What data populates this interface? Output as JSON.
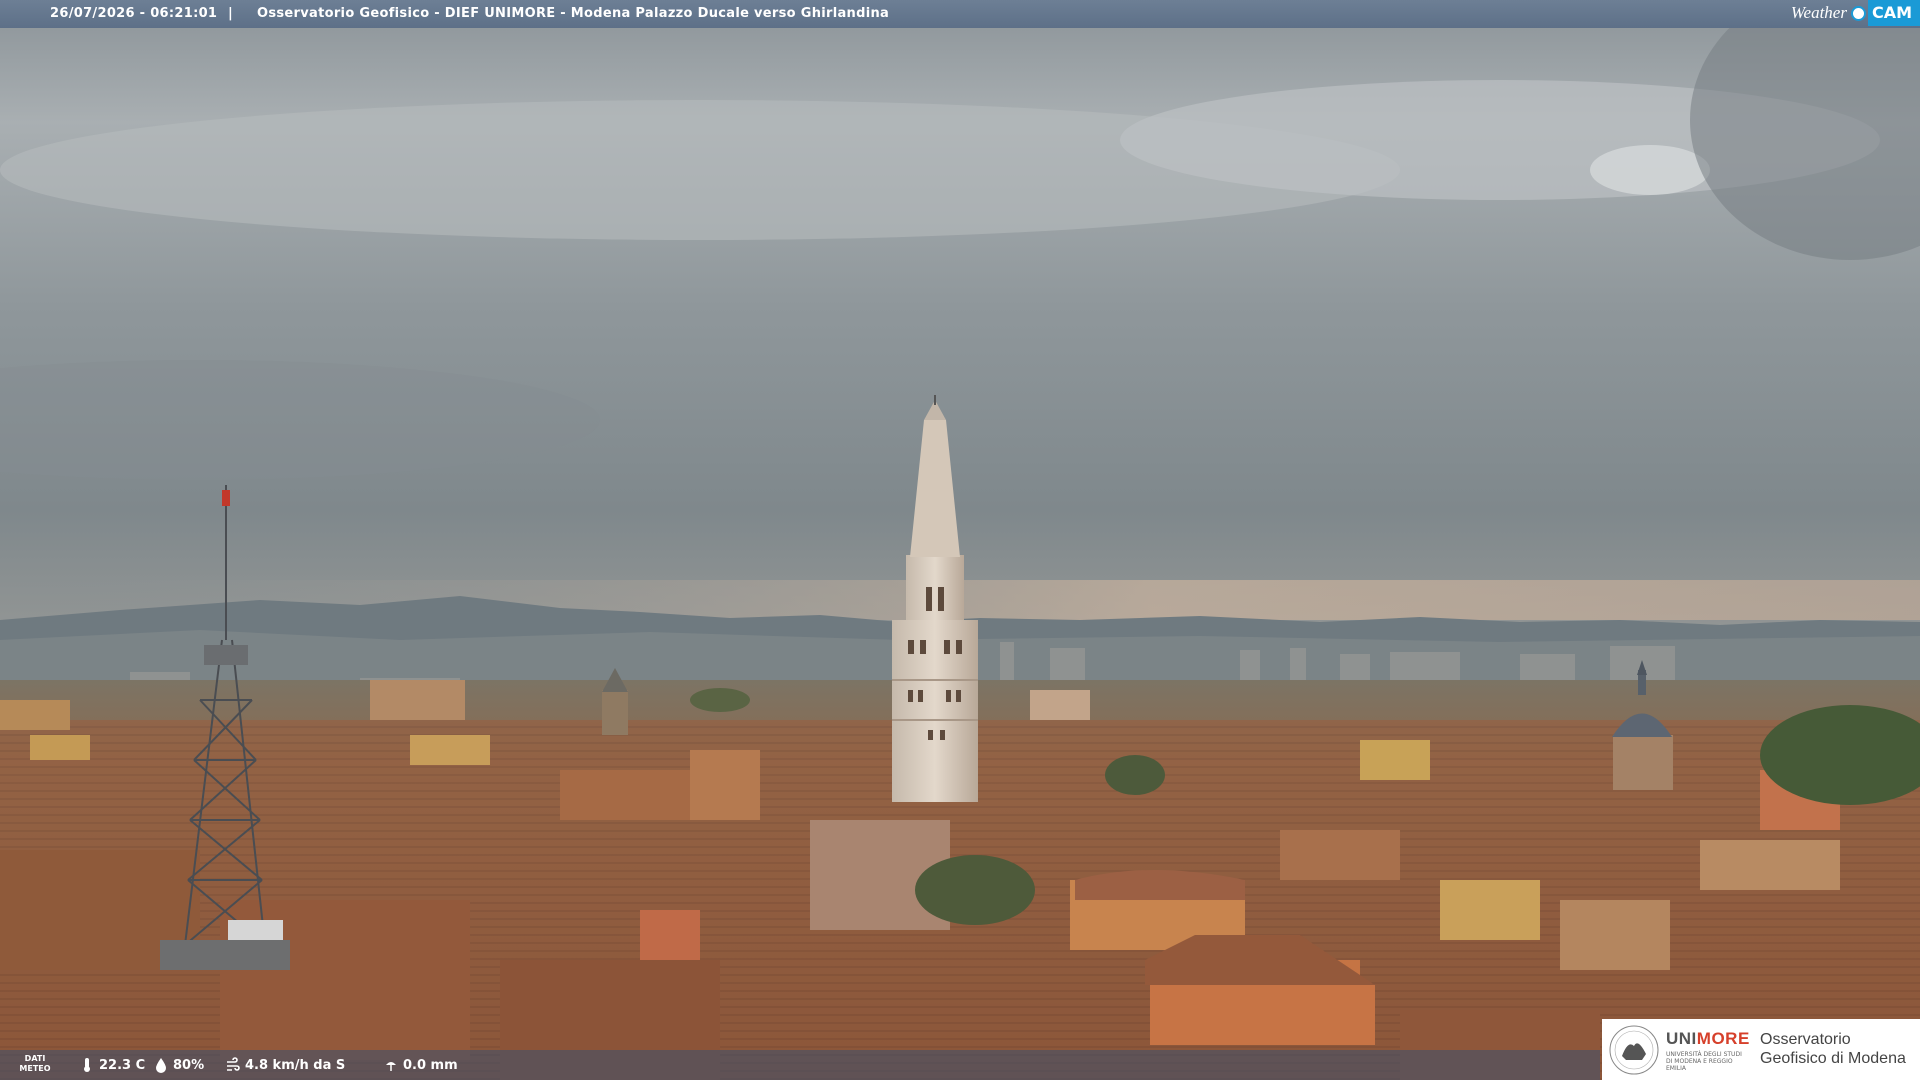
{
  "header": {
    "timestamp": "26/07/2026 - 06:21:01",
    "separator": "|",
    "title": "Osservatorio Geofisico - DIEF UNIMORE - Modena Palazzo Ducale verso Ghirlandina",
    "brand_weather": "Weather",
    "brand_cam": "CAM"
  },
  "weather": {
    "label": "DATI METEO",
    "temperature": "22.3 C",
    "humidity": "80%",
    "wind": "4.8 km/h da S",
    "rain": "0.0 mm",
    "icons": [
      "thermometer-icon",
      "humidity-drop-icon",
      "wind-icon",
      "rain-gauge-icon"
    ]
  },
  "logo": {
    "uni": "UNI",
    "more": "MORE",
    "university": "UNIVERSITÀ DEGLI STUDI DI MODENA E REGGIO EMILIA",
    "observatory": "Osservatorio Geofisico di Modena"
  },
  "colors": {
    "bar": "#5d7088",
    "accent_blue": "#1a9ad6",
    "unimore_red": "#d6402b",
    "roof": "#a0613e",
    "sky": "#9aa3a8"
  }
}
